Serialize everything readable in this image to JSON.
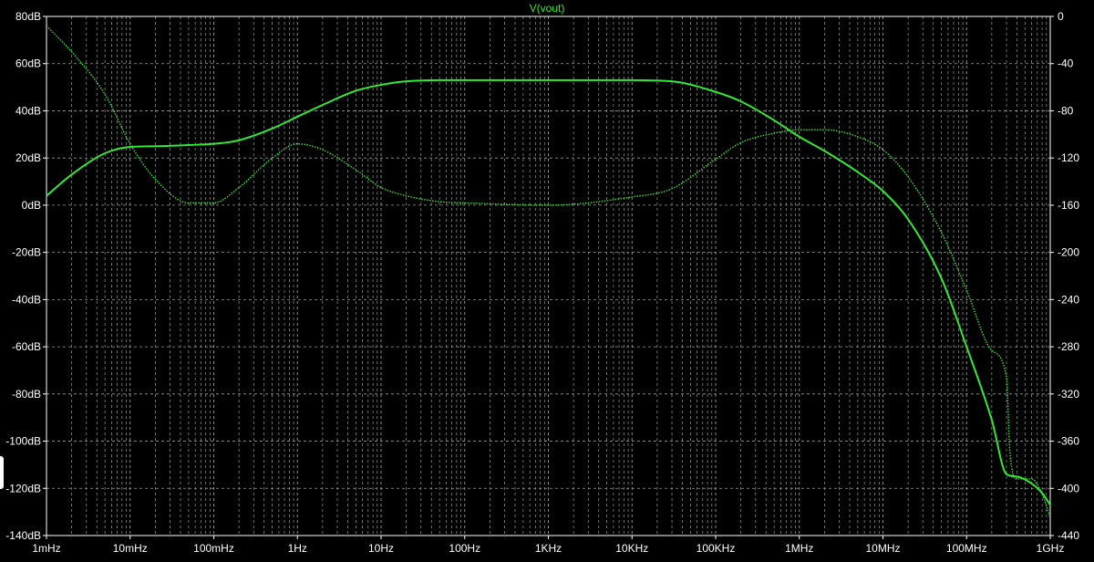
{
  "chart_data": {
    "type": "line",
    "title": "V(vout)",
    "x_scale": "log",
    "x_ticks": [
      {
        "value": 0.001,
        "label": "1mHz"
      },
      {
        "value": 0.01,
        "label": "10mHz"
      },
      {
        "value": 0.1,
        "label": "100mHz"
      },
      {
        "value": 1,
        "label": "1Hz"
      },
      {
        "value": 10,
        "label": "10Hz"
      },
      {
        "value": 100,
        "label": "100Hz"
      },
      {
        "value": 1000,
        "label": "1KHz"
      },
      {
        "value": 10000,
        "label": "10KHz"
      },
      {
        "value": 100000,
        "label": "100KHz"
      },
      {
        "value": 1000000,
        "label": "1MHz"
      },
      {
        "value": 10000000,
        "label": "10MHz"
      },
      {
        "value": 100000000,
        "label": "100MHz"
      },
      {
        "value": 1000000000,
        "label": "1GHz"
      }
    ],
    "xlim": [
      0.001,
      1000000000
    ],
    "y_left": {
      "ylim": [
        -140,
        80
      ],
      "ticks": [
        80,
        60,
        40,
        20,
        0,
        -20,
        -40,
        -60,
        -80,
        -100,
        -120,
        -140
      ],
      "labels": [
        "80dB",
        "60dB",
        "40dB",
        "20dB",
        "0dB",
        "-20dB",
        "-40dB",
        "-60dB",
        "-80dB",
        "-100dB",
        "-120dB",
        "-140dB"
      ]
    },
    "y_right": {
      "ylim": [
        -440,
        0
      ],
      "ticks": [
        0,
        -40,
        -80,
        -120,
        -160,
        -200,
        -240,
        -280,
        -320,
        -360,
        -400,
        -440
      ],
      "labels": [
        "0",
        "-40",
        "-80",
        "-120",
        "-160",
        "-200",
        "-240",
        "-280",
        "-320",
        "-360",
        "-400",
        "-440"
      ]
    },
    "grid": true,
    "colors": {
      "background": "#000000",
      "trace": "#33e833",
      "grid": "#9a9a9a",
      "axes": "#ffffff"
    },
    "series": [
      {
        "axis": "left",
        "style": "solid",
        "x": [
          0.001,
          0.002,
          0.005,
          0.01,
          0.02,
          0.05,
          0.1,
          0.2,
          0.5,
          1,
          2,
          5,
          10,
          20,
          50,
          100,
          1000,
          10000,
          30000,
          100000,
          200000,
          500000,
          1000000,
          2000000,
          5000000,
          10000000,
          20000000,
          50000000,
          100000000,
          200000000,
          300000000,
          400000000,
          600000000,
          800000000,
          1000000000
        ],
        "values": [
          4,
          13,
          22,
          24.7,
          25,
          25.5,
          26,
          27.5,
          32.5,
          37.5,
          42.5,
          48.5,
          51,
          52.5,
          53,
          53,
          53,
          53,
          52.5,
          48,
          44,
          36,
          29,
          23,
          14,
          6,
          -6,
          -31,
          -60,
          -91,
          -114,
          -115,
          -118,
          -122,
          -127
        ]
      },
      {
        "axis": "right",
        "style": "dotted",
        "x": [
          0.001,
          0.002,
          0.005,
          0.01,
          0.02,
          0.05,
          0.1,
          0.2,
          0.5,
          1,
          2,
          5,
          10,
          20,
          50,
          100,
          1000,
          10000,
          30000,
          100000,
          200000,
          500000,
          1000000,
          2000000,
          5000000,
          10000000,
          20000000,
          50000000,
          100000000,
          200000000,
          300000000,
          330000000,
          400000000,
          600000000,
          800000000,
          1000000000
        ],
        "values": [
          -8,
          -30,
          -66,
          -108,
          -138,
          -158,
          -158,
          -145,
          -120,
          -108,
          -113,
          -130,
          -145,
          -152,
          -157,
          -158,
          -160,
          -153,
          -146,
          -121,
          -107,
          -99,
          -96,
          -96,
          -102,
          -113,
          -136,
          -183,
          -232,
          -283,
          -306,
          -370,
          -392,
          -392,
          -405,
          -425
        ]
      }
    ]
  }
}
